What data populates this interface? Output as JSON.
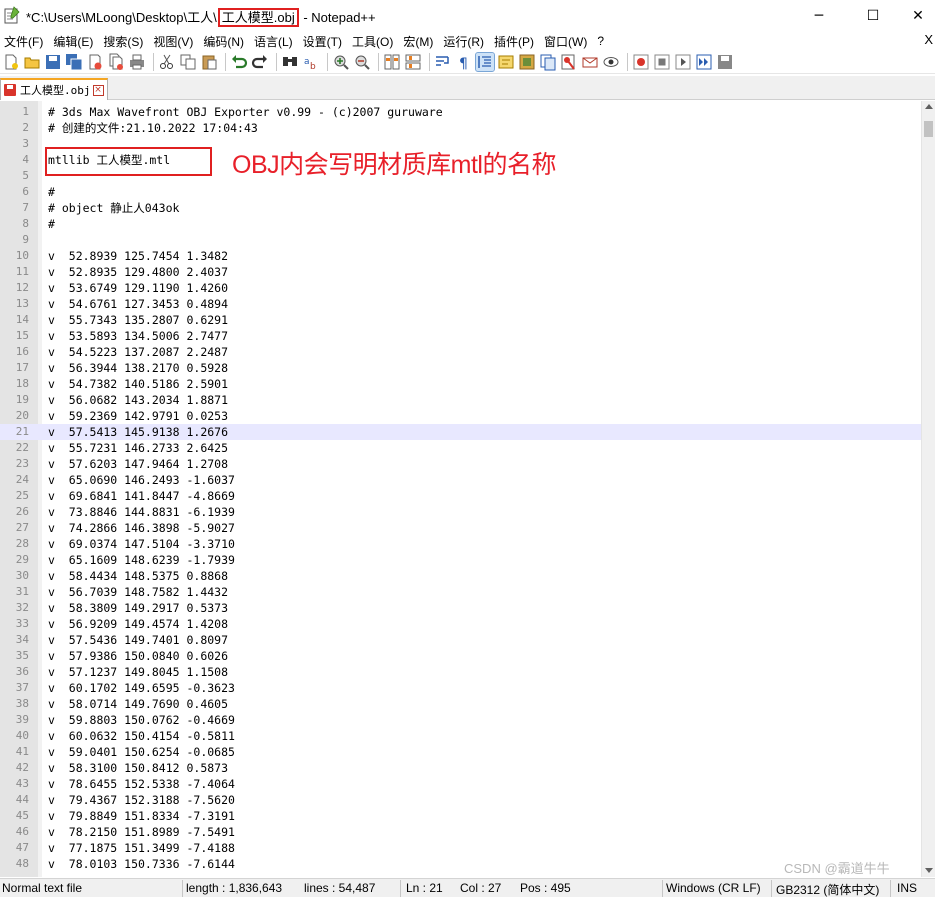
{
  "window": {
    "title_prefix": "*C:\\Users\\MLoong\\Desktop\\工人\\",
    "title_file": "工人模型.obj",
    "title_suffix": " - Notepad++",
    "min_glyph": "─",
    "max_glyph": "☐",
    "close_glyph": "✕"
  },
  "menu": {
    "items": [
      "文件(F)",
      "编辑(E)",
      "搜索(S)",
      "视图(V)",
      "编码(N)",
      "语言(L)",
      "设置(T)",
      "工具(O)",
      "宏(M)",
      "运行(R)",
      "插件(P)",
      "窗口(W)",
      "?"
    ],
    "close_glyph": "X"
  },
  "toolbar": {
    "icons": [
      "new-file",
      "open-file",
      "save",
      "save-all",
      "close",
      "close-all",
      "print",
      "cut",
      "copy",
      "paste",
      "undo",
      "redo",
      "find",
      "replace",
      "zoom-in",
      "zoom-out",
      "sync-vertical",
      "sync-horizontal",
      "word-wrap",
      "show-all-chars",
      "indent-guide",
      "user-language",
      "doc-map",
      "function-list",
      "folder-as-workspace",
      "monitoring",
      "record-macro",
      "stop-macro",
      "play-macro",
      "run-macro-multiple",
      "save-macro"
    ],
    "active_icon": "indent-guide"
  },
  "tab": {
    "label": "工人模型.obj",
    "close_glyph": "×"
  },
  "editor": {
    "current_line": 21,
    "lines": [
      {
        "n": "1",
        "t": "# 3ds Max Wavefront OBJ Exporter v0.99 - (c)2007 guruware"
      },
      {
        "n": "2",
        "t": "# 创建的文件:21.10.2022 17:04:43"
      },
      {
        "n": "3",
        "t": ""
      },
      {
        "n": "4",
        "t": "mtllib 工人模型.mtl"
      },
      {
        "n": "5",
        "t": ""
      },
      {
        "n": "6",
        "t": "#"
      },
      {
        "n": "7",
        "t": "# object 静止人043ok"
      },
      {
        "n": "8",
        "t": "#"
      },
      {
        "n": "9",
        "t": ""
      },
      {
        "n": "10",
        "t": "v  52.8939 125.7454 1.3482"
      },
      {
        "n": "11",
        "t": "v  52.8935 129.4800 2.4037"
      },
      {
        "n": "12",
        "t": "v  53.6749 129.1190 1.4260"
      },
      {
        "n": "13",
        "t": "v  54.6761 127.3453 0.4894"
      },
      {
        "n": "14",
        "t": "v  55.7343 135.2807 0.6291"
      },
      {
        "n": "15",
        "t": "v  53.5893 134.5006 2.7477"
      },
      {
        "n": "16",
        "t": "v  54.5223 137.2087 2.2487"
      },
      {
        "n": "17",
        "t": "v  56.3944 138.2170 0.5928"
      },
      {
        "n": "18",
        "t": "v  54.7382 140.5186 2.5901"
      },
      {
        "n": "19",
        "t": "v  56.0682 143.2034 1.8871"
      },
      {
        "n": "20",
        "t": "v  59.2369 142.9791 0.0253"
      },
      {
        "n": "21",
        "t": "v  57.5413 145.9138 1.2676"
      },
      {
        "n": "22",
        "t": "v  55.7231 146.2733 2.6425"
      },
      {
        "n": "23",
        "t": "v  57.6203 147.9464 1.2708"
      },
      {
        "n": "24",
        "t": "v  65.0690 146.2493 -1.6037"
      },
      {
        "n": "25",
        "t": "v  69.6841 141.8447 -4.8669"
      },
      {
        "n": "26",
        "t": "v  73.8846 144.8831 -6.1939"
      },
      {
        "n": "27",
        "t": "v  74.2866 146.3898 -5.9027"
      },
      {
        "n": "28",
        "t": "v  69.0374 147.5104 -3.3710"
      },
      {
        "n": "29",
        "t": "v  65.1609 148.6239 -1.7939"
      },
      {
        "n": "30",
        "t": "v  58.4434 148.5375 0.8868"
      },
      {
        "n": "31",
        "t": "v  56.7039 148.7582 1.4432"
      },
      {
        "n": "32",
        "t": "v  58.3809 149.2917 0.5373"
      },
      {
        "n": "33",
        "t": "v  56.9209 149.4574 1.4208"
      },
      {
        "n": "34",
        "t": "v  57.5436 149.7401 0.8097"
      },
      {
        "n": "35",
        "t": "v  57.9386 150.0840 0.6026"
      },
      {
        "n": "36",
        "t": "v  57.1237 149.8045 1.1508"
      },
      {
        "n": "37",
        "t": "v  60.1702 149.6595 -0.3623"
      },
      {
        "n": "38",
        "t": "v  58.0714 149.7690 0.4605"
      },
      {
        "n": "39",
        "t": "v  59.8803 150.0762 -0.4669"
      },
      {
        "n": "40",
        "t": "v  60.0632 150.4154 -0.5811"
      },
      {
        "n": "41",
        "t": "v  59.0401 150.6254 -0.0685"
      },
      {
        "n": "42",
        "t": "v  58.3100 150.8412 0.5873"
      },
      {
        "n": "43",
        "t": "v  78.6455 152.5338 -7.4064"
      },
      {
        "n": "44",
        "t": "v  79.4367 152.3188 -7.5620"
      },
      {
        "n": "45",
        "t": "v  79.8849 151.8334 -7.3191"
      },
      {
        "n": "46",
        "t": "v  78.2150 151.8989 -7.5491"
      },
      {
        "n": "47",
        "t": "v  77.1875 151.3499 -7.4188"
      },
      {
        "n": "48",
        "t": "v  78.0103 150.7336 -7.6144"
      }
    ]
  },
  "annotation": {
    "text": "OBJ内会写明材质库mtl的名称"
  },
  "watermark": "CSDN @霸道牛牛",
  "status": {
    "type": "Normal text file",
    "length": "length : 1,836,643",
    "lines": "lines : 54,487",
    "ln": "Ln : 21",
    "col": "Col : 27",
    "pos": "Pos : 495",
    "eol": "Windows (CR LF)",
    "encoding": "GB2312 (简体中文)",
    "mode": "INS"
  }
}
